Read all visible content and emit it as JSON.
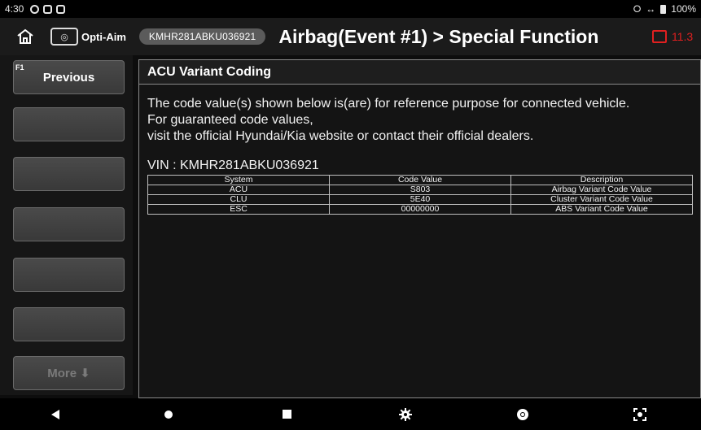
{
  "status_bar": {
    "time": "4:30",
    "battery_percent": "100%"
  },
  "header": {
    "opti_aim_label": "Opti-Aim",
    "vin_badge": "KMHR281ABKU036921",
    "title": "Airbag(Event #1) > Special Function",
    "battery_voltage": "11.3"
  },
  "sidebar": {
    "f1_key": "F1",
    "previous_label": "Previous",
    "more_label": "More ⬇"
  },
  "panel": {
    "title": "ACU Variant Coding",
    "message_lines": [
      "The code value(s) shown below is(are) for reference purpose for connected vehicle.",
      "For guaranteed code values,",
      "visit the official Hyundai/Kia website or contact their official dealers."
    ],
    "vin_line": "VIN : KMHR281ABKU036921",
    "table": {
      "headers": [
        "System",
        "Code Value",
        "Description"
      ],
      "rows": [
        [
          "ACU",
          "S803",
          "Airbag Variant Code Value"
        ],
        [
          "CLU",
          "5E40",
          "Cluster Variant Code Value"
        ],
        [
          "ESC",
          "00000000",
          "ABS Variant Code Value"
        ]
      ]
    }
  },
  "colors": {
    "alert_red": "#e02020",
    "button_gray": "#4a4a4a"
  }
}
